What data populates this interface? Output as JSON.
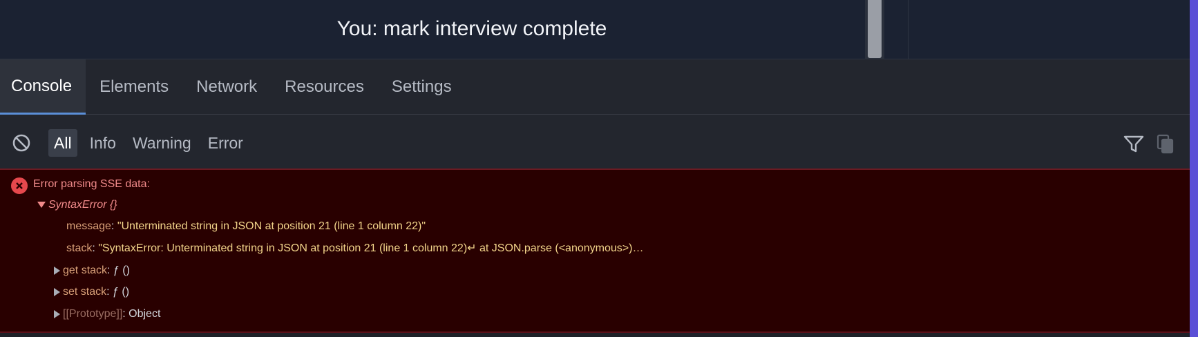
{
  "chat": {
    "message": "You: mark interview complete"
  },
  "devtools": {
    "tabs": [
      {
        "label": "Console",
        "active": true
      },
      {
        "label": "Elements",
        "active": false
      },
      {
        "label": "Network",
        "active": false
      },
      {
        "label": "Resources",
        "active": false
      },
      {
        "label": "Settings",
        "active": false
      }
    ],
    "filters": {
      "clear_icon": "clear-console-icon",
      "levels": [
        {
          "label": "All",
          "active": true
        },
        {
          "label": "Info",
          "active": false
        },
        {
          "label": "Warning",
          "active": false
        },
        {
          "label": "Error",
          "active": false
        }
      ],
      "filter_icon": "funnel-icon",
      "copy_icon": "copy-icon"
    },
    "console": {
      "error_header": "Error parsing SSE data:",
      "object_label": "SyntaxError {}",
      "properties": {
        "message_key": "message",
        "message_value": "\"Unterminated string in JSON at position 21 (line 1 column 22)\"",
        "stack_key": "stack",
        "stack_value": "\"SyntaxError: Unterminated string in JSON at position 21 (line 1 column 22)↵ at JSON.parse (<anonymous>)…",
        "get_stack_key": "get stack",
        "get_stack_value": "ƒ ()",
        "set_stack_key": "set stack",
        "set_stack_value": "ƒ ()",
        "prototype_key": "[[Prototype]]",
        "prototype_value": "Object"
      }
    }
  },
  "colors": {
    "accent": "#5b4fd6",
    "error_bg": "#290000",
    "error_text": "#f08a8a",
    "string_value": "#f2d48a",
    "property_key": "#d9a078"
  }
}
